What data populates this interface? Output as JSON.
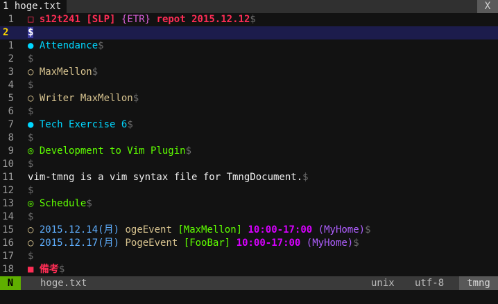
{
  "tabline": {
    "tab_number": "1",
    "tab_title": "hoge.txt",
    "close_label": "X"
  },
  "colors": {
    "background": "#121212",
    "cursorline": "#1c1c4c",
    "mode_bg": "#5faf00",
    "accent_red": "#ff2d55"
  },
  "lines": [
    {
      "num": "1",
      "current": false,
      "segments": [
        {
          "text": "□",
          "cls": "c-red",
          "icon": "square-outline-icon"
        },
        {
          "text": " "
        },
        {
          "text": "s12t241",
          "cls": "c-redb"
        },
        {
          "text": " "
        },
        {
          "text": "[SLP]",
          "cls": "c-redb"
        },
        {
          "text": " "
        },
        {
          "text": "{ETR}",
          "cls": "c-pink"
        },
        {
          "text": " "
        },
        {
          "text": "repot 2015.12.12",
          "cls": "c-redb"
        },
        {
          "text": "$",
          "cls": "eol"
        }
      ]
    },
    {
      "num": "2",
      "current": true,
      "segments": [
        {
          "text": "$",
          "cls": "cursor"
        }
      ]
    },
    {
      "num": "1",
      "current": false,
      "segments": [
        {
          "text": "●",
          "cls": "c-cyan",
          "icon": "bullet-filled-icon"
        },
        {
          "text": " "
        },
        {
          "text": "Attendance",
          "cls": "c-cyan"
        },
        {
          "text": "$",
          "cls": "eol"
        }
      ]
    },
    {
      "num": "2",
      "current": false,
      "segments": [
        {
          "text": "$",
          "cls": "eol"
        }
      ]
    },
    {
      "num": "3",
      "current": false,
      "segments": [
        {
          "text": "○",
          "cls": "c-tan",
          "icon": "bullet-outline-icon"
        },
        {
          "text": " "
        },
        {
          "text": "MaxMellon",
          "cls": "c-tan"
        },
        {
          "text": "$",
          "cls": "eol"
        }
      ]
    },
    {
      "num": "4",
      "current": false,
      "segments": [
        {
          "text": "$",
          "cls": "eol"
        }
      ]
    },
    {
      "num": "5",
      "current": false,
      "segments": [
        {
          "text": "○",
          "cls": "c-tan",
          "icon": "bullet-outline-icon"
        },
        {
          "text": " "
        },
        {
          "text": "Writer MaxMellon",
          "cls": "c-tan"
        },
        {
          "text": "$",
          "cls": "eol"
        }
      ]
    },
    {
      "num": "6",
      "current": false,
      "segments": [
        {
          "text": "$",
          "cls": "eol"
        }
      ]
    },
    {
      "num": "7",
      "current": false,
      "segments": [
        {
          "text": "●",
          "cls": "c-cyan",
          "icon": "bullet-filled-icon"
        },
        {
          "text": " "
        },
        {
          "text": "Tech Exercise 6",
          "cls": "c-cyan"
        },
        {
          "text": "$",
          "cls": "eol"
        }
      ]
    },
    {
      "num": "8",
      "current": false,
      "segments": [
        {
          "text": "$",
          "cls": "eol"
        }
      ]
    },
    {
      "num": "9",
      "current": false,
      "segments": [
        {
          "text": "◎",
          "cls": "c-green",
          "icon": "bullseye-icon"
        },
        {
          "text": " "
        },
        {
          "text": "Development to Vim Plugin",
          "cls": "c-green"
        },
        {
          "text": "$",
          "cls": "eol"
        }
      ]
    },
    {
      "num": "10",
      "current": false,
      "segments": [
        {
          "text": "$",
          "cls": "eol"
        }
      ]
    },
    {
      "num": "11",
      "current": false,
      "segments": [
        {
          "text": "vim-tmng is a vim syntax file for TmngDocument.",
          "cls": "c-white"
        },
        {
          "text": "$",
          "cls": "eol"
        }
      ]
    },
    {
      "num": "12",
      "current": false,
      "segments": [
        {
          "text": "$",
          "cls": "eol"
        }
      ]
    },
    {
      "num": "13",
      "current": false,
      "segments": [
        {
          "text": "◎",
          "cls": "c-green",
          "icon": "bullseye-icon"
        },
        {
          "text": " "
        },
        {
          "text": "Schedule",
          "cls": "c-green"
        },
        {
          "text": "$",
          "cls": "eol"
        }
      ]
    },
    {
      "num": "14",
      "current": false,
      "segments": [
        {
          "text": "$",
          "cls": "eol"
        }
      ]
    },
    {
      "num": "15",
      "current": false,
      "segments": [
        {
          "text": "○",
          "cls": "c-tan",
          "icon": "bullet-outline-icon"
        },
        {
          "text": " "
        },
        {
          "text": "2015.12.14(月)",
          "cls": "c-blue"
        },
        {
          "text": " "
        },
        {
          "text": "ogeEvent",
          "cls": "c-tan"
        },
        {
          "text": " "
        },
        {
          "text": "[MaxMellon]",
          "cls": "c-green"
        },
        {
          "text": " "
        },
        {
          "text": "10:00-17:00",
          "cls": "c-magb"
        },
        {
          "text": " "
        },
        {
          "text": "(MyHome)",
          "cls": "c-purple"
        },
        {
          "text": "$",
          "cls": "eol"
        }
      ]
    },
    {
      "num": "16",
      "current": false,
      "segments": [
        {
          "text": "○",
          "cls": "c-tan",
          "icon": "bullet-outline-icon"
        },
        {
          "text": " "
        },
        {
          "text": "2015.12.17(月)",
          "cls": "c-blue"
        },
        {
          "text": " "
        },
        {
          "text": "PogeEvent",
          "cls": "c-tan"
        },
        {
          "text": " "
        },
        {
          "text": "[FooBar]",
          "cls": "c-green"
        },
        {
          "text": " "
        },
        {
          "text": "10:00-17:00",
          "cls": "c-magb"
        },
        {
          "text": " "
        },
        {
          "text": "(MyHome)",
          "cls": "c-purple"
        },
        {
          "text": "$",
          "cls": "eol"
        }
      ]
    },
    {
      "num": "17",
      "current": false,
      "segments": [
        {
          "text": "$",
          "cls": "eol"
        }
      ]
    },
    {
      "num": "18",
      "current": false,
      "segments": [
        {
          "text": "■",
          "cls": "c-red",
          "icon": "square-filled-icon"
        },
        {
          "text": " "
        },
        {
          "text": "備考",
          "cls": "c-redb"
        },
        {
          "text": "$",
          "cls": "eol"
        }
      ]
    }
  ],
  "statusline": {
    "mode": "N",
    "filename": "hoge.txt",
    "fileformat": "unix",
    "encoding": "utf-8",
    "filetype": "tmng"
  }
}
